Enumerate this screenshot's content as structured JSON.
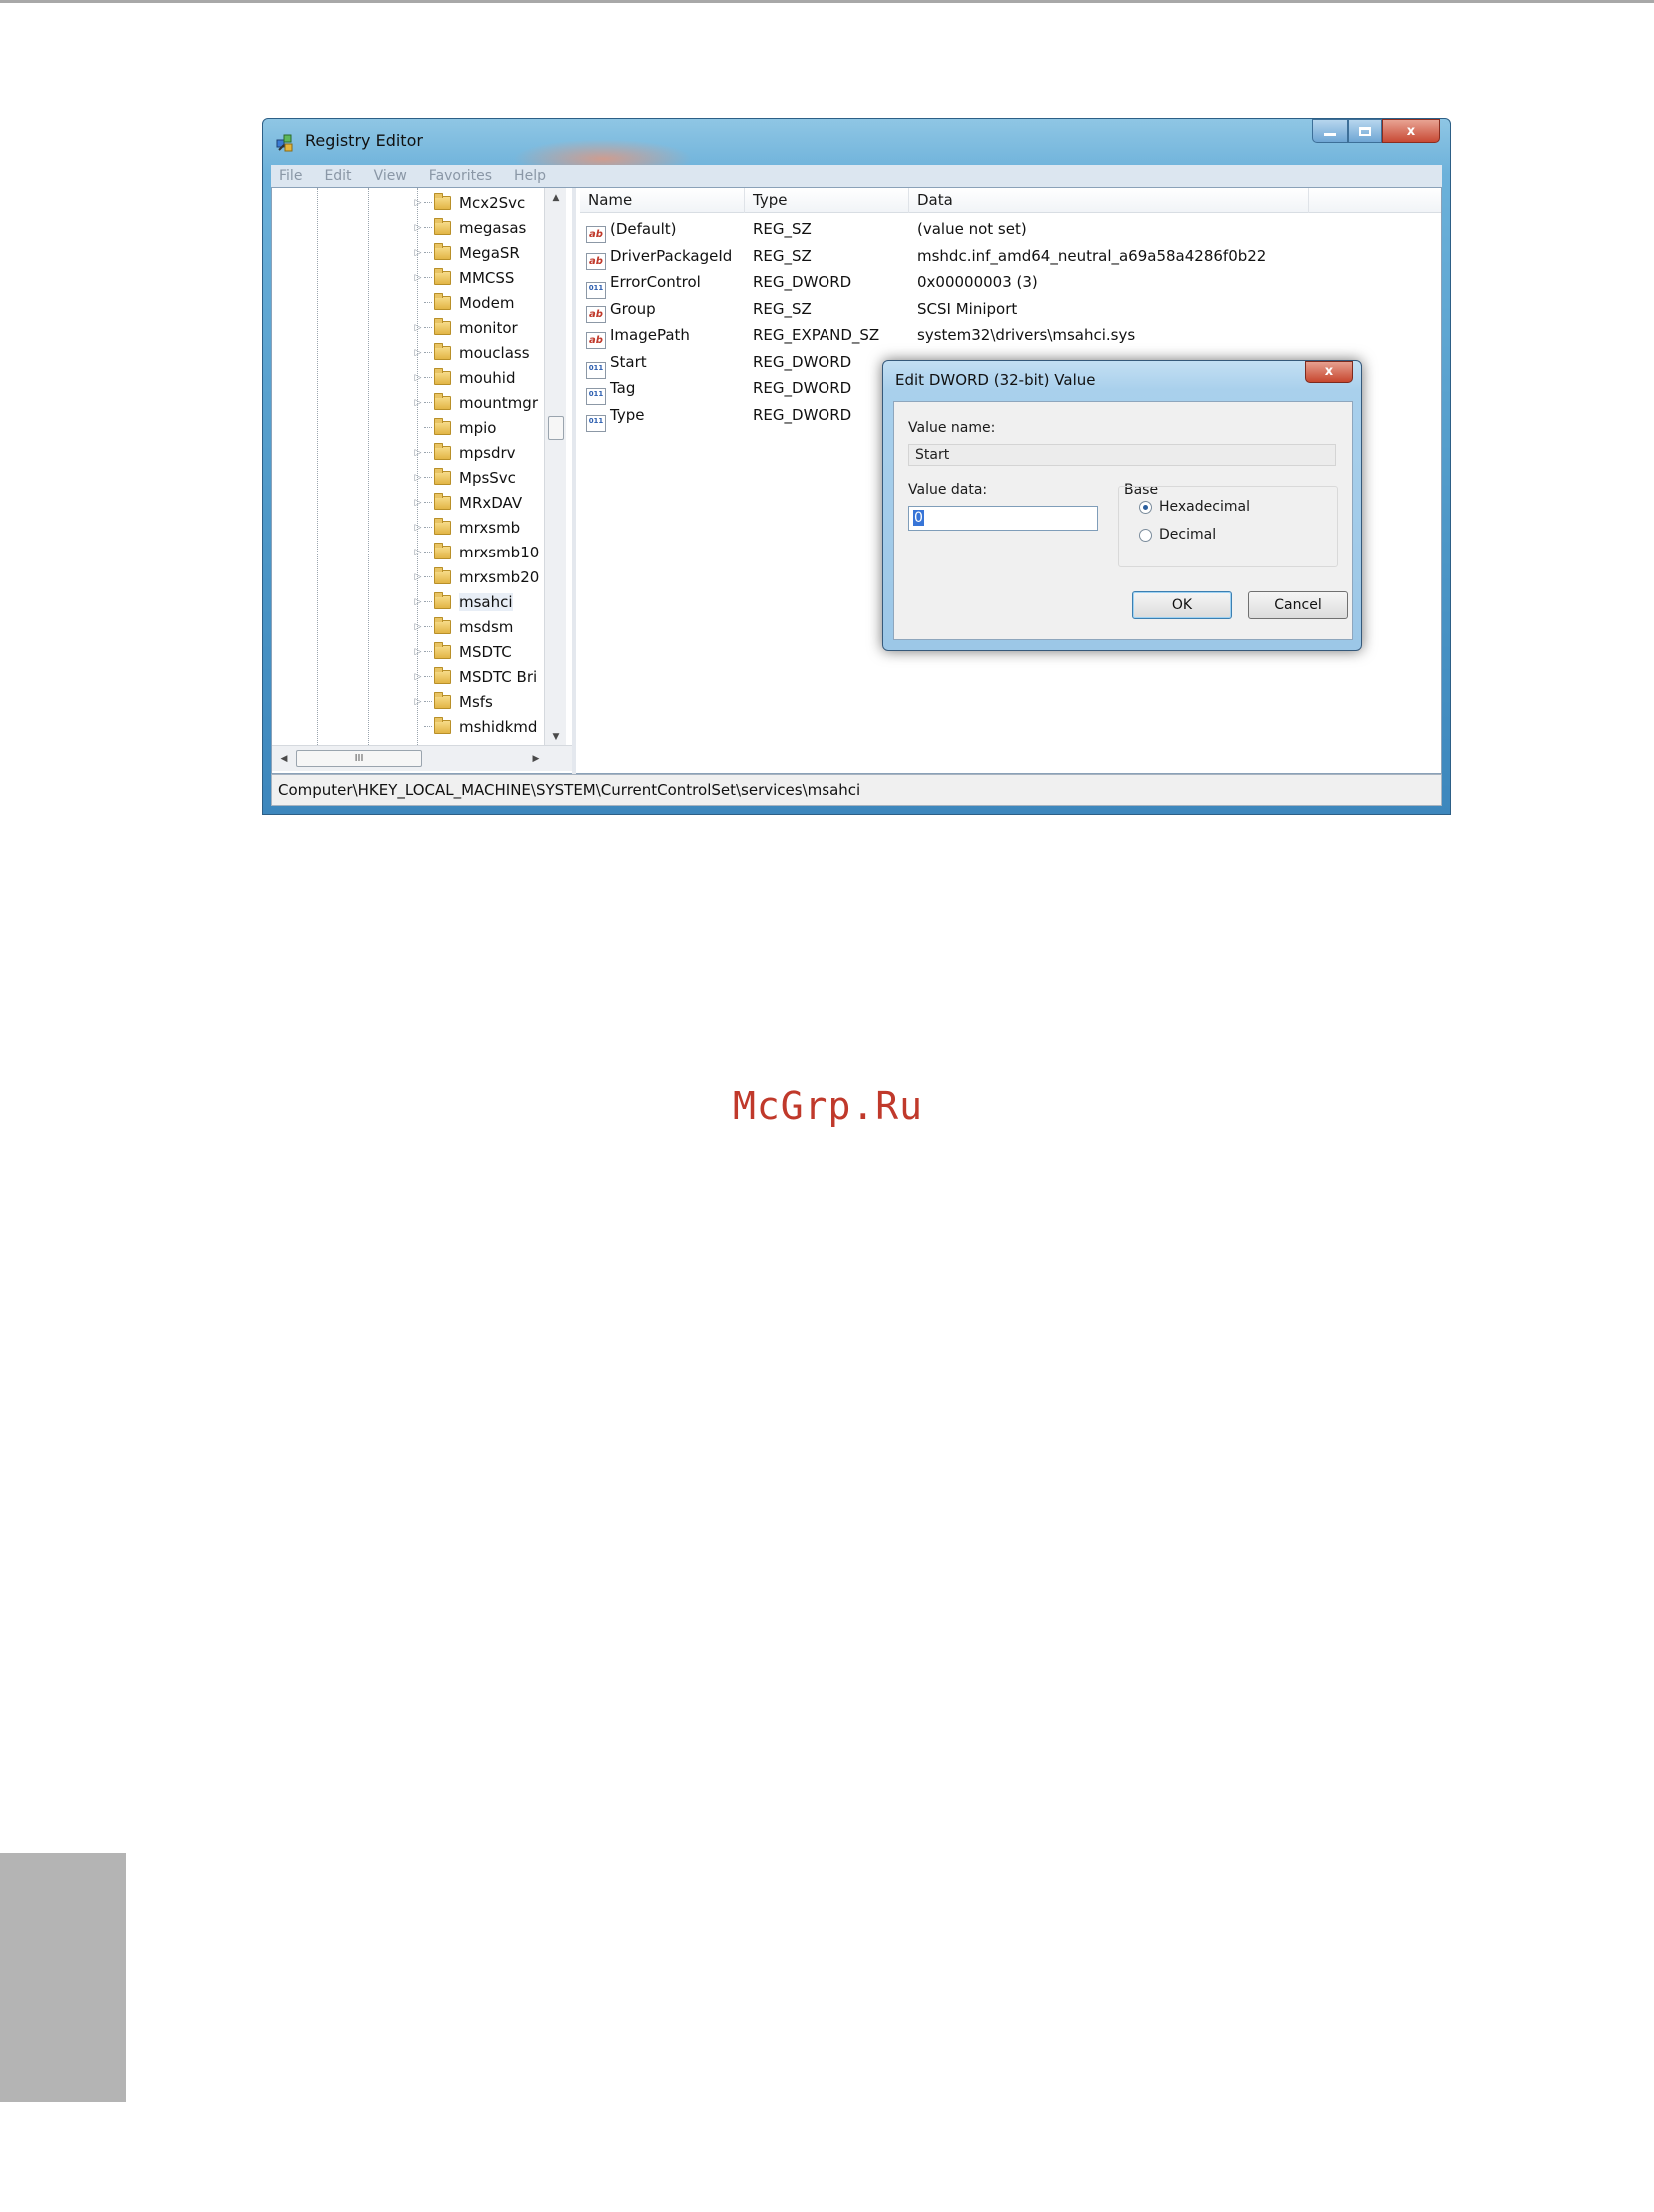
{
  "watermark": "McGrp.Ru",
  "window": {
    "title": "Registry Editor",
    "icon": "registry-editor-icon",
    "caption": {
      "minimize": "minimize-icon",
      "maximize": "maximize-icon",
      "close_glyph": "x"
    }
  },
  "menu": {
    "file": "File",
    "edit": "Edit",
    "view": "View",
    "favorites": "Favorites",
    "help": "Help"
  },
  "tree": {
    "items": [
      {
        "label": "Mcx2Svc",
        "expander": "▷"
      },
      {
        "label": "megasas",
        "expander": "▷"
      },
      {
        "label": "MegaSR",
        "expander": "▷"
      },
      {
        "label": "MMCSS",
        "expander": "▷"
      },
      {
        "label": "Modem",
        "expander": ""
      },
      {
        "label": "monitor",
        "expander": "▷"
      },
      {
        "label": "mouclass",
        "expander": "▷"
      },
      {
        "label": "mouhid",
        "expander": "▷"
      },
      {
        "label": "mountmgr",
        "expander": "▷"
      },
      {
        "label": "mpio",
        "expander": ""
      },
      {
        "label": "mpsdrv",
        "expander": "▷"
      },
      {
        "label": "MpsSvc",
        "expander": "▷"
      },
      {
        "label": "MRxDAV",
        "expander": "▷"
      },
      {
        "label": "mrxsmb",
        "expander": "▷"
      },
      {
        "label": "mrxsmb10",
        "expander": "▷"
      },
      {
        "label": "mrxsmb20",
        "expander": "▷"
      },
      {
        "label": "msahci",
        "expander": "▷"
      },
      {
        "label": "msdsm",
        "expander": "▷"
      },
      {
        "label": "MSDTC",
        "expander": "▷"
      },
      {
        "label": "MSDTC Bri",
        "expander": "▷"
      },
      {
        "label": "Msfs",
        "expander": "▷"
      },
      {
        "label": "mshidkmd",
        "expander": ""
      }
    ],
    "hscroll_grip": "III"
  },
  "list": {
    "columns": {
      "name": "Name",
      "type": "Type",
      "data": "Data"
    },
    "rows": [
      {
        "icon": "ab",
        "name": "(Default)",
        "type": "REG_SZ",
        "data": "(value not set)"
      },
      {
        "icon": "ab",
        "name": "DriverPackageId",
        "type": "REG_SZ",
        "data": "mshdc.inf_amd64_neutral_a69a58a4286f0b22"
      },
      {
        "icon": "011",
        "name": "ErrorControl",
        "type": "REG_DWORD",
        "data": "0x00000003 (3)"
      },
      {
        "icon": "ab",
        "name": "Group",
        "type": "REG_SZ",
        "data": "SCSI Miniport"
      },
      {
        "icon": "ab",
        "name": "ImagePath",
        "type": "REG_EXPAND_SZ",
        "data": "system32\\drivers\\msahci.sys"
      },
      {
        "icon": "011",
        "name": "Start",
        "type": "REG_DWORD",
        "data": ""
      },
      {
        "icon": "011",
        "name": "Tag",
        "type": "REG_DWORD",
        "data": ""
      },
      {
        "icon": "011",
        "name": "Type",
        "type": "REG_DWORD",
        "data": ""
      }
    ]
  },
  "statusbar": {
    "path": "Computer\\HKEY_LOCAL_MACHINE\\SYSTEM\\CurrentControlSet\\services\\msahci"
  },
  "dialog": {
    "title": "Edit DWORD (32-bit) Value",
    "close_glyph": "x",
    "value_name_label": "Value name:",
    "value_name": "Start",
    "value_data_label": "Value data:",
    "value_data": "0",
    "base_label": "Base",
    "base_options": [
      {
        "label": "Hexadecimal",
        "selected": true
      },
      {
        "label": "Decimal",
        "selected": false
      }
    ],
    "ok_label": "OK",
    "cancel_label": "Cancel"
  },
  "colors": {
    "watermark": "#c0392b",
    "title_bar": "#6cb1da",
    "close_button": "#c84a35",
    "side_tab": "#b4b4b4"
  }
}
